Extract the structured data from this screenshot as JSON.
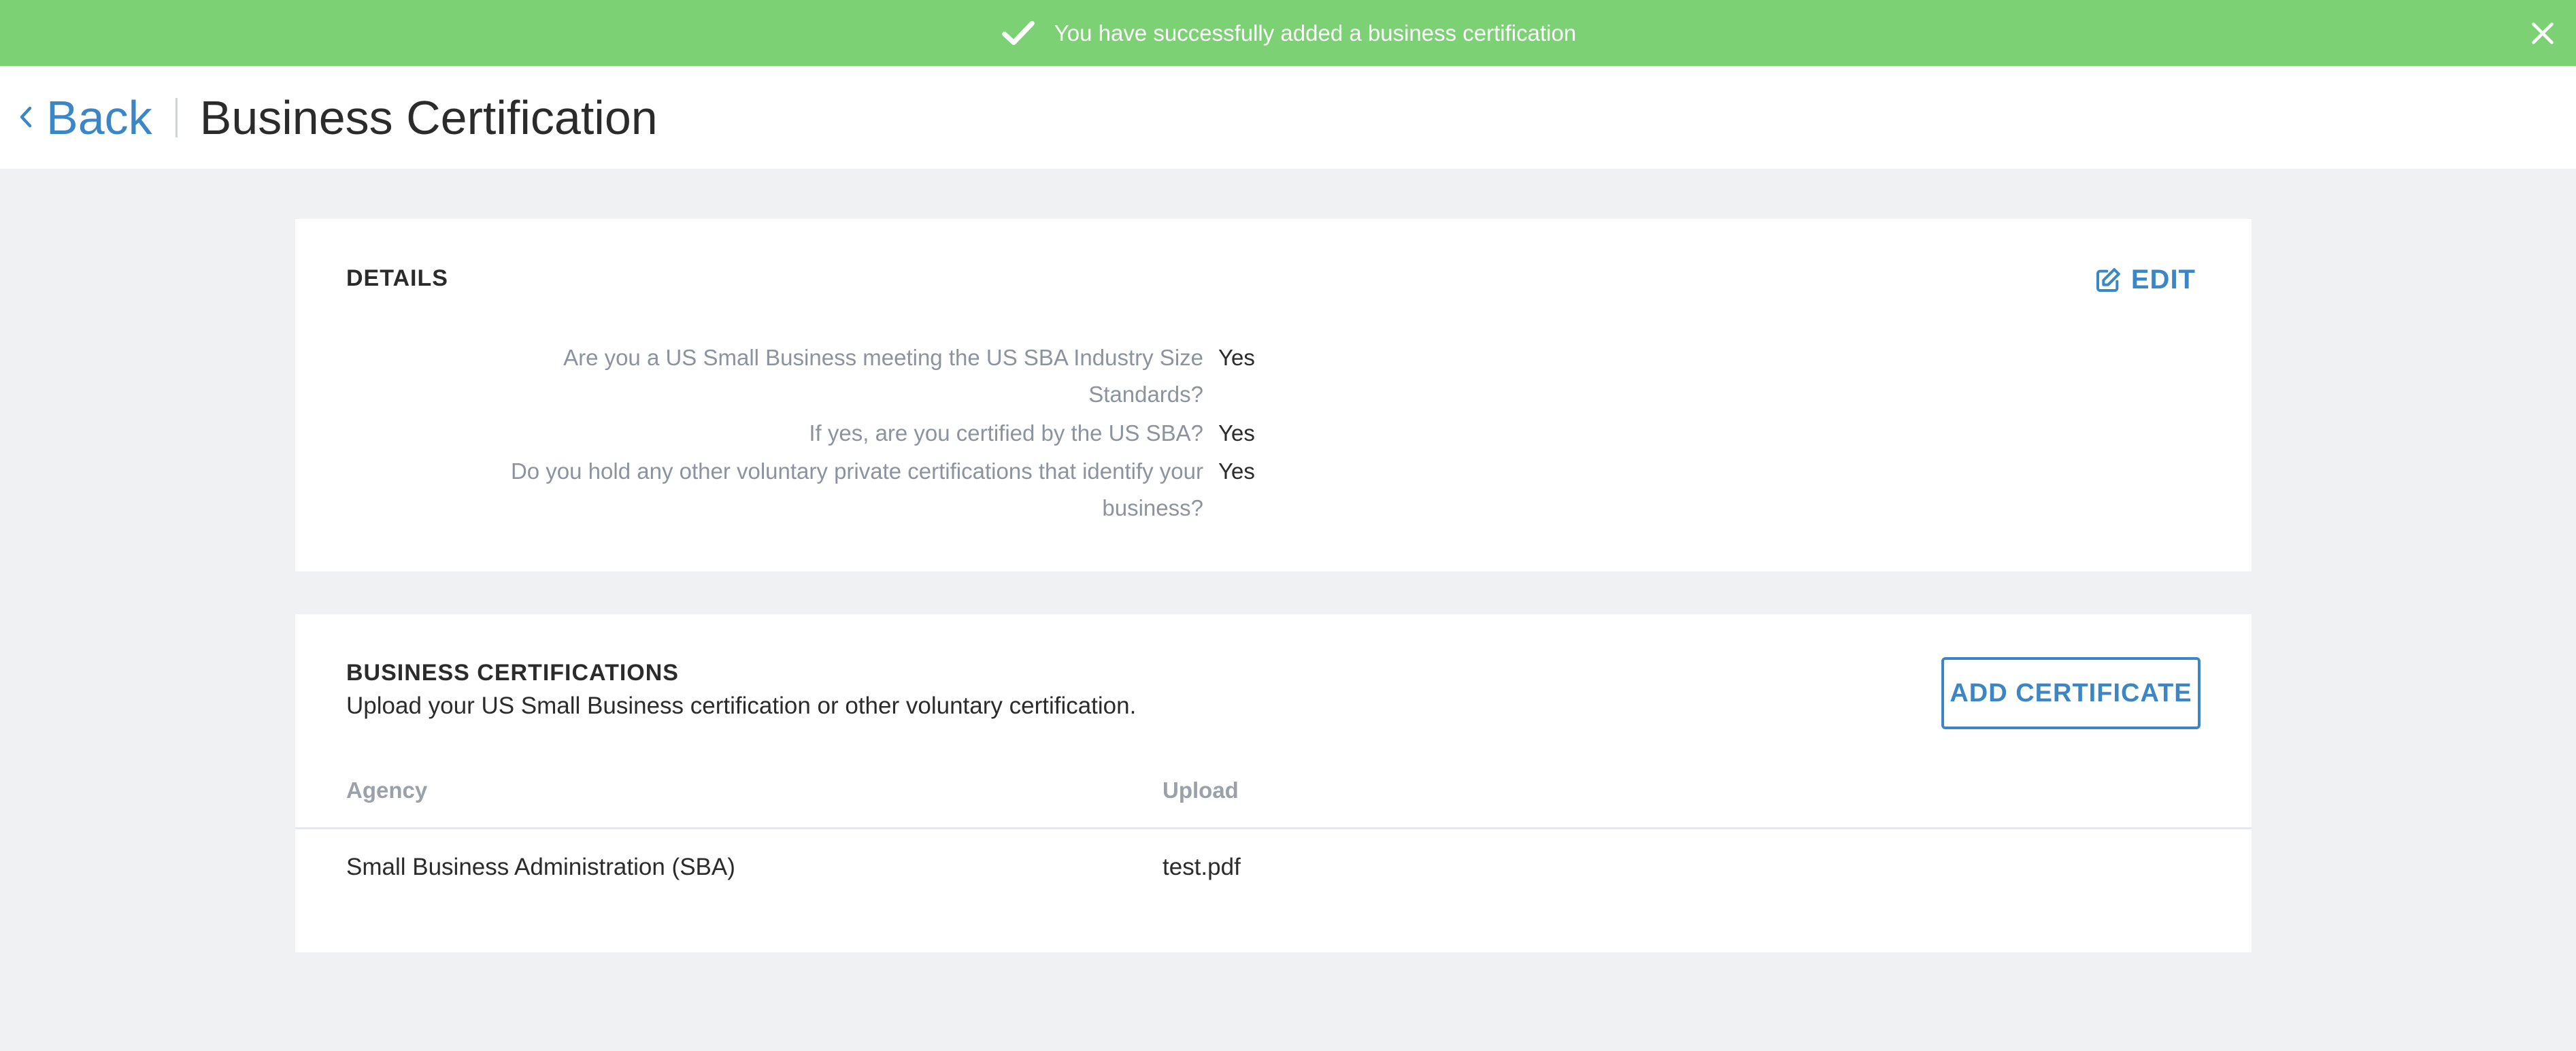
{
  "banner": {
    "message": "You have successfully added a business certification",
    "color": "#7bd174",
    "icon": "check-icon",
    "close_icon": "close-icon"
  },
  "header": {
    "back_label": "Back",
    "back_icon": "chevron-left-icon",
    "title": "Business Certification"
  },
  "details": {
    "title": "DETAILS",
    "edit_label": "EDIT",
    "edit_icon": "edit-icon",
    "rows": [
      {
        "question": "Are you a US Small Business meeting the US SBA Industry Size Standards?",
        "answer": "Yes"
      },
      {
        "question": "If yes, are you certified by the US SBA?",
        "answer": "Yes"
      },
      {
        "question": "Do you hold any other voluntary private certifications that identify your business?",
        "answer": "Yes"
      }
    ]
  },
  "certifications": {
    "title": "BUSINESS CERTIFICATIONS",
    "subtitle": "Upload your US Small Business certification or other voluntary certification.",
    "add_label": "ADD CERTIFICATE",
    "columns": [
      "Agency",
      "Upload"
    ],
    "rows": [
      {
        "agency": "Small Business Administration (SBA)",
        "upload": "test.pdf"
      }
    ]
  },
  "colors": {
    "accent": "#3b86c6",
    "success": "#7bd174",
    "background": "#f0f1f3"
  }
}
